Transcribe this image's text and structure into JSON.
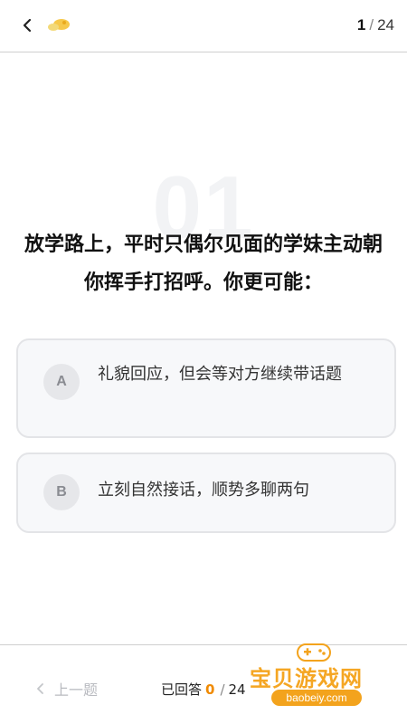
{
  "header": {
    "progress_current": "1",
    "progress_separator": "/",
    "progress_total": "24"
  },
  "question": {
    "number": "01",
    "text": "放学路上，平时只偶尔见面的学妹主动朝你挥手打招呼。你更可能："
  },
  "options": [
    {
      "letter": "A",
      "text": "礼貌回应，但会等对方继续带话题"
    },
    {
      "letter": "B",
      "text": "立刻自然接话，顺势多聊两句"
    }
  ],
  "footer": {
    "prev_label": "上一题",
    "answered_label": "已回答",
    "answered_count": "0",
    "answered_separator": "/",
    "answered_total": "24"
  },
  "watermark": {
    "title": "宝贝游戏网",
    "url": "baobeiy.com"
  },
  "colors": {
    "accent": "#f08a00",
    "option_bg": "#f7f8fa",
    "option_border": "#e3e4e7",
    "divider": "#cfcfcf"
  }
}
